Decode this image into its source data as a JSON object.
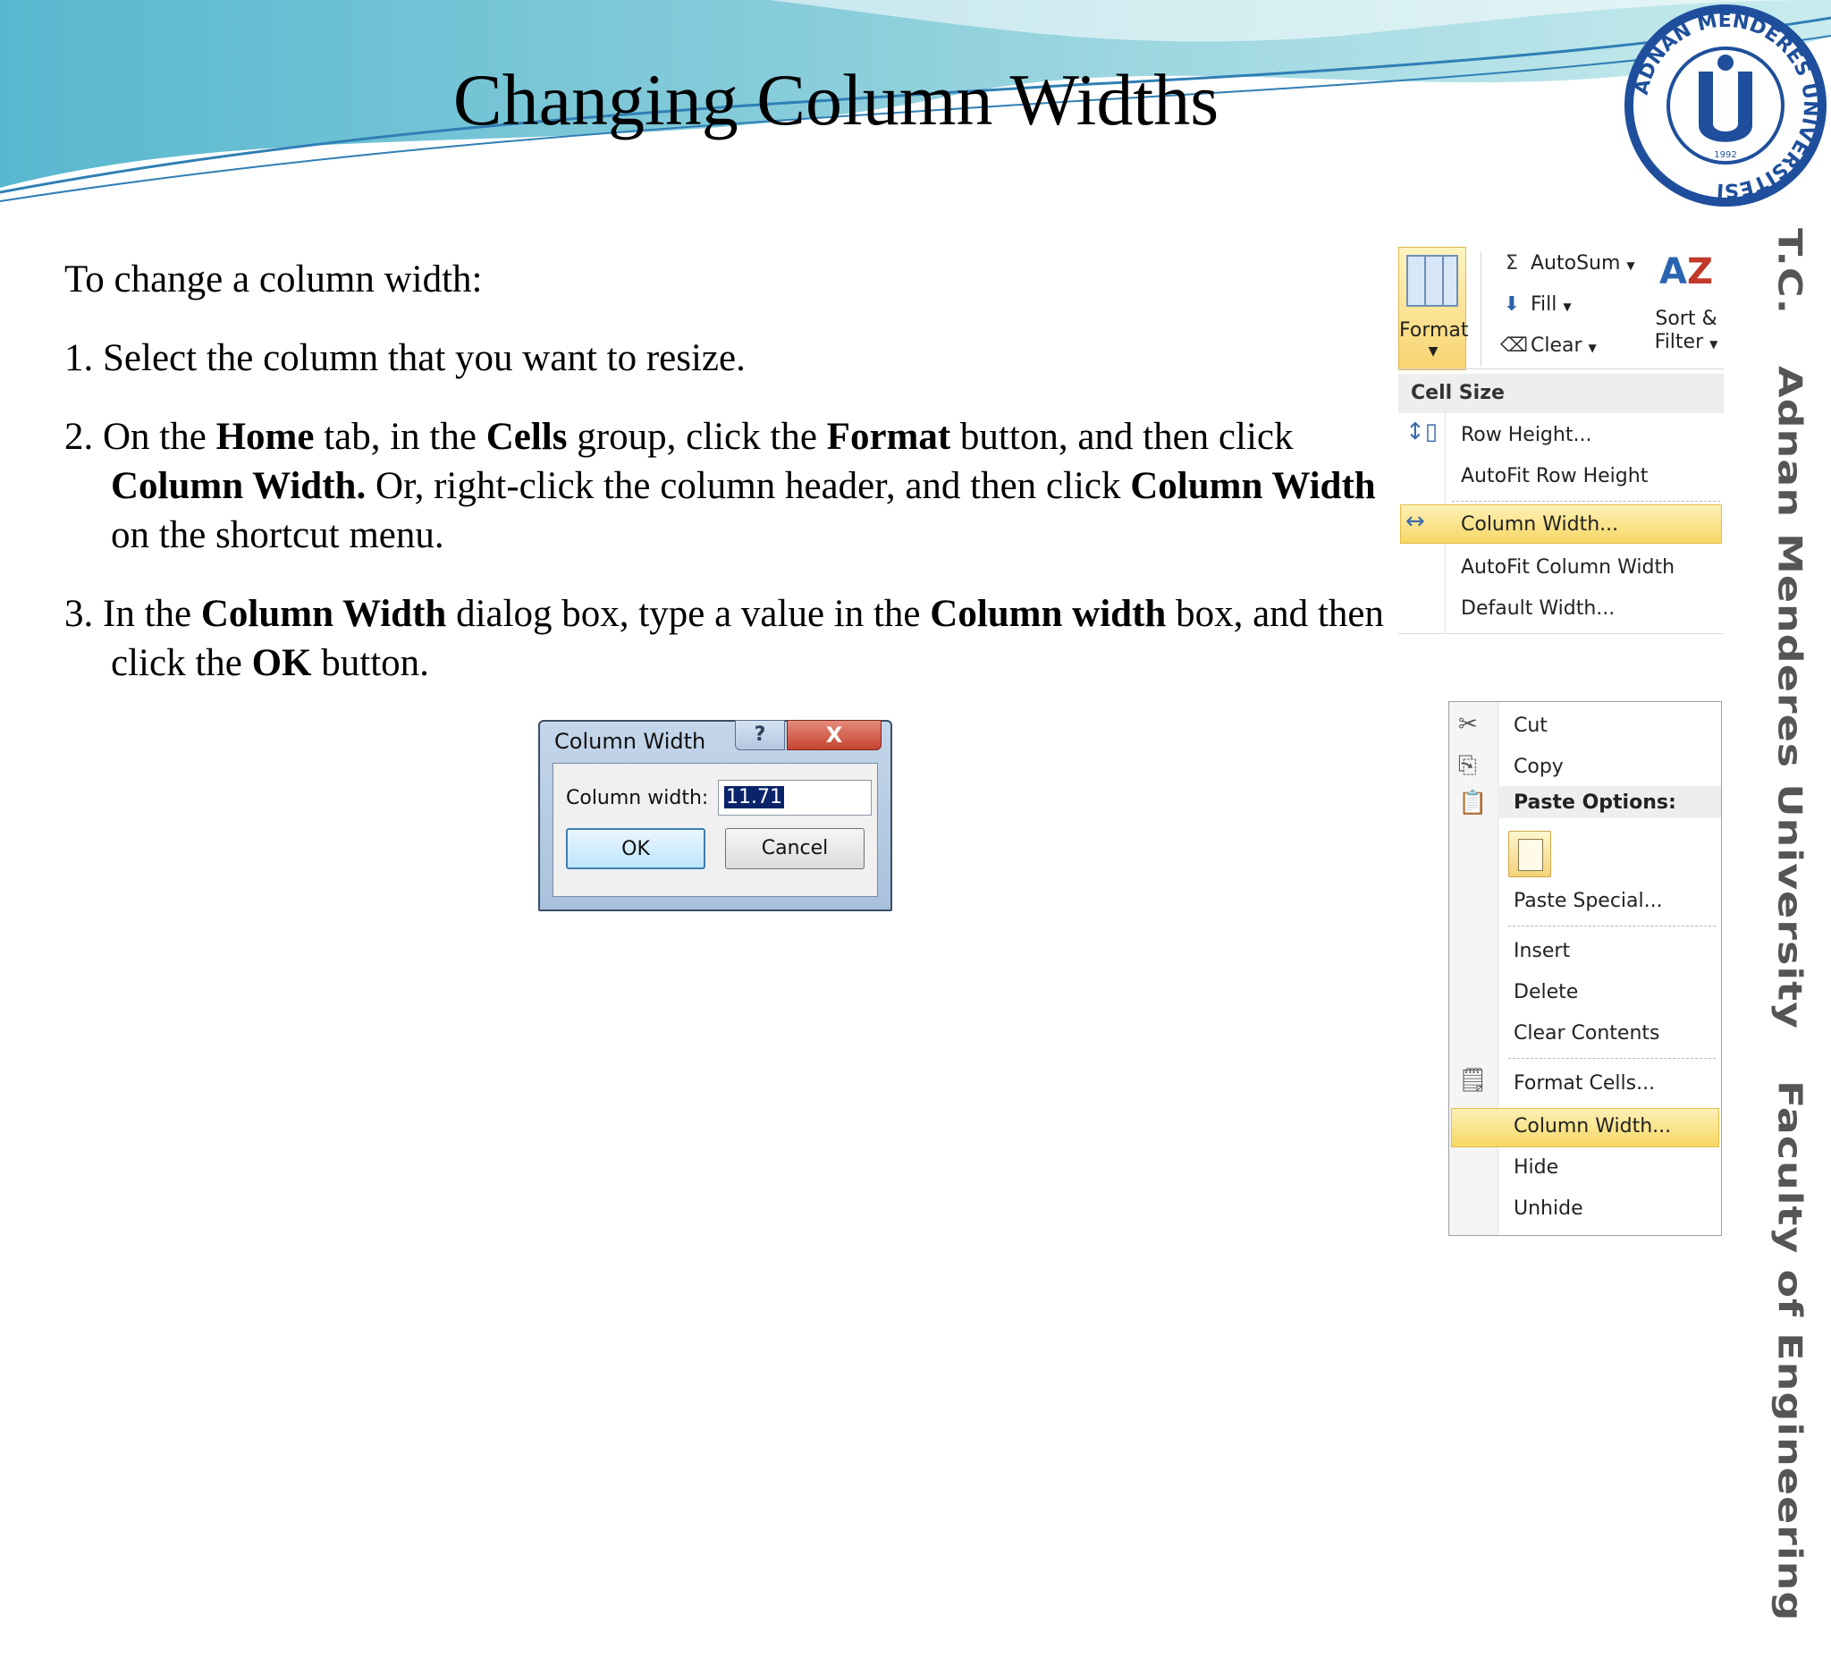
{
  "slide": {
    "title": "Changing Column Widths",
    "vertical_text": [
      "T.C.",
      "Adnan Menderes University",
      "Faculty of Engineering"
    ],
    "logo_text": "ADNAN MENDERES ÜNİVERSİTESİ",
    "logo_year": "1992"
  },
  "body": {
    "intro": "To change a column width:",
    "step1": "1. Select the column that you want to resize.",
    "step2": {
      "t1": "2. On the ",
      "b1": "Home",
      "t2": " tab, in the ",
      "b2": "Cells",
      "t3": " group, click the ",
      "b3": "Format",
      "t4": " button, and then click ",
      "b4": "Column Width.",
      "t5": " Or, right-click the column header, and then click ",
      "b5": "Column Width",
      "t6": " on the shortcut menu."
    },
    "step3": {
      "t1": "3. In the ",
      "b1": "Column Width",
      "t2": " dialog box, type a value in the ",
      "b2": "Column width",
      "t3": " box, and then click the ",
      "b3": "OK",
      "t4": " button."
    }
  },
  "dialog": {
    "title": "Column Width",
    "help_label": "?",
    "close_label": "X",
    "field_label": "Column width:",
    "field_value": "11.71",
    "ok_label": "OK",
    "cancel_label": "Cancel"
  },
  "ribbon": {
    "format_label": "Format",
    "autosum_label": "AutoSum",
    "fill_label": "Fill",
    "clear_label": "Clear",
    "sort_label_1": "Sort &",
    "sort_label_2": "Filter"
  },
  "format_menu": {
    "header": "Cell Size",
    "items": [
      "Row Height...",
      "AutoFit Row Height",
      "Column Width...",
      "AutoFit Column Width",
      "Default Width..."
    ],
    "highlighted_index": 2
  },
  "context_menu": {
    "items": {
      "cut": "Cut",
      "copy": "Copy",
      "paste_options": "Paste Options:",
      "paste_special": "Paste Special...",
      "insert": "Insert",
      "delete": "Delete",
      "clear_contents": "Clear Contents",
      "format_cells": "Format Cells...",
      "column_width": "Column Width...",
      "hide": "Hide",
      "unhide": "Unhide"
    },
    "highlighted": "column_width"
  },
  "colors": {
    "header_wave": "#4bb4c8",
    "logo_blue": "#1f4f9c",
    "highlight": "#f7d865"
  }
}
